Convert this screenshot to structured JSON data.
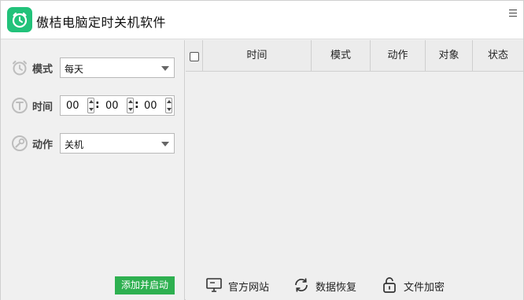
{
  "window": {
    "title": "傲桔电脑定时关机软件",
    "menu_icon": "hamburger-menu-icon",
    "logo_icon": "alarm-clock-icon",
    "accent_color": "#22c27a"
  },
  "settings": {
    "mode": {
      "label": "模式",
      "icon": "alarm-clock-icon",
      "value": "每天"
    },
    "time": {
      "label": "时间",
      "icon": "timer-t-icon",
      "hour": "00",
      "minute": "00",
      "second": "00",
      "separator": ":"
    },
    "action": {
      "label": "动作",
      "icon": "wrench-icon",
      "value": "关机"
    },
    "add_button": {
      "label": "添加并启动",
      "color": "#2eb050"
    }
  },
  "table": {
    "columns": [
      "时间",
      "模式",
      "动作",
      "对象",
      "状态"
    ],
    "rows": []
  },
  "footer": {
    "website": {
      "label": "官方网站",
      "icon": "monitor-icon"
    },
    "restore": {
      "label": "数据恢复",
      "icon": "refresh-icon"
    },
    "encrypt": {
      "label": "文件加密",
      "icon": "lock-icon"
    }
  }
}
